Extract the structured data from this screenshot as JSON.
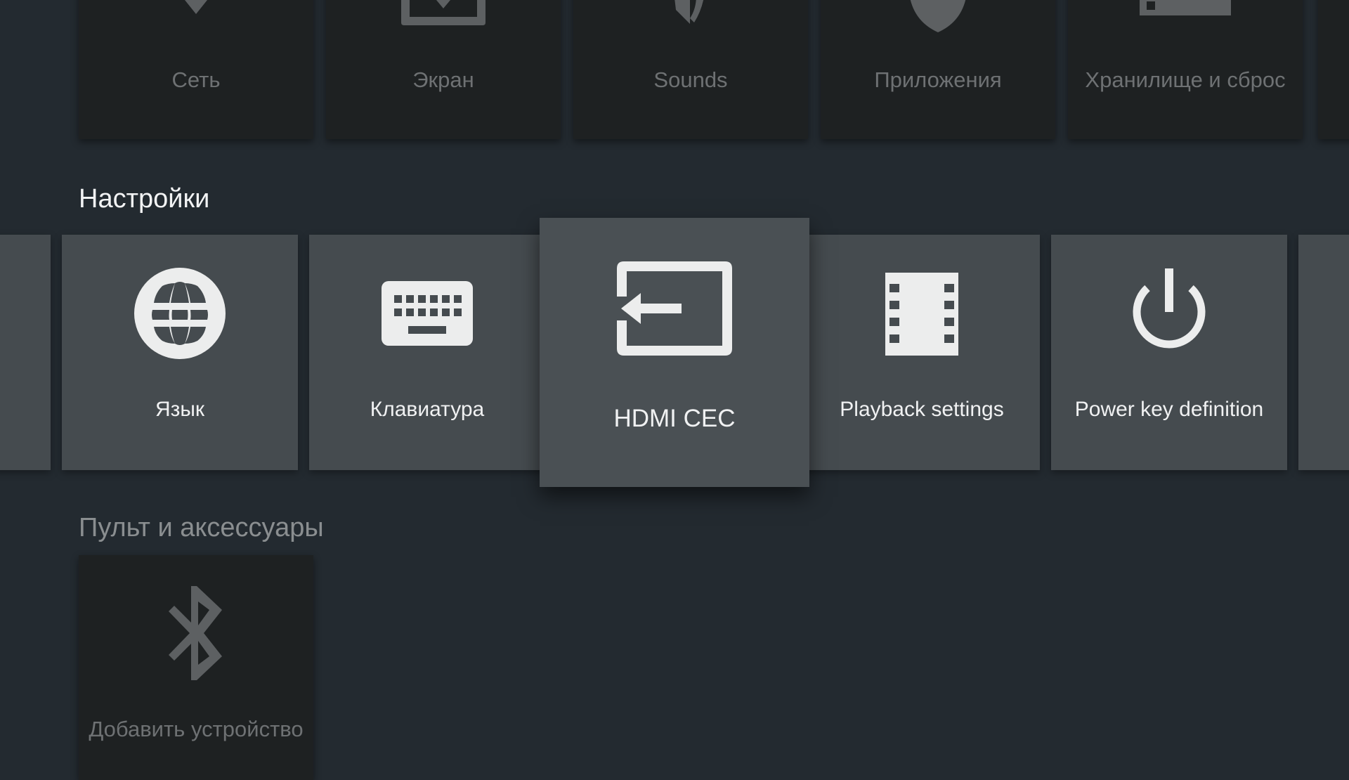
{
  "top_row": {
    "items": [
      {
        "label": "Сеть",
        "icon": "wifi-icon"
      },
      {
        "label": "Экран",
        "icon": "display-icon"
      },
      {
        "label": "Sounds",
        "icon": "volume-icon"
      },
      {
        "label": "Приложения",
        "icon": "apps-icon"
      },
      {
        "label": "Хранилище и сброс",
        "icon": "storage-icon"
      }
    ]
  },
  "settings": {
    "title": "Настройки",
    "items": [
      {
        "label": "Язык",
        "icon": "globe-icon"
      },
      {
        "label": "Клавиатура",
        "icon": "keyboard-icon"
      },
      {
        "label": "HDMI CEC",
        "icon": "input-icon",
        "focused": true
      },
      {
        "label": "Playback settings",
        "icon": "film-icon"
      },
      {
        "label": "Power key definition",
        "icon": "power-icon"
      }
    ]
  },
  "remote": {
    "title": "Пульт и аксессуары",
    "items": [
      {
        "label": "Добавить устройство",
        "icon": "bluetooth-icon"
      }
    ]
  },
  "colors": {
    "background": "#232a30",
    "card_focused": "#4a5054",
    "card_normal": "#454b4f",
    "card_dim": "#1e2122"
  }
}
